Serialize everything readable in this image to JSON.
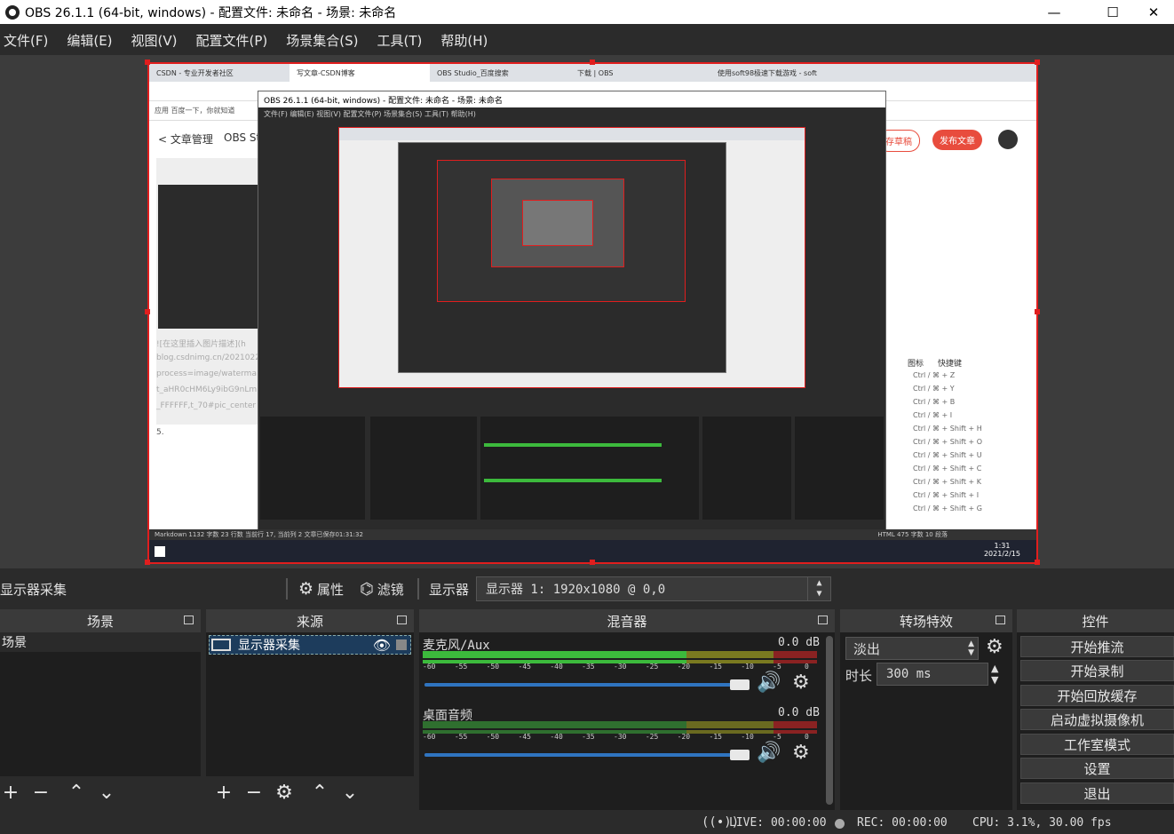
{
  "window": {
    "title": "OBS 26.1.1 (64-bit, windows) - 配置文件: 未命名 - 场景: 未命名",
    "minimize": "—",
    "maximize": "☐",
    "close": "✕"
  },
  "menu": [
    "文件(F)",
    "编辑(E)",
    "视图(V)",
    "配置文件(P)",
    "场景集合(S)",
    "工具(T)",
    "帮助(H)"
  ],
  "preview": {
    "browser_tabs": [
      "CSDN - 专业开发者社区",
      "写文章-CSDN博客",
      "OBS Studio_百度搜索",
      "下载 | OBS",
      "使用soft98极速下载游戏 - soft"
    ],
    "bookmarks": "应用   百度一下，你就知道",
    "editor_back": "< 文章管理",
    "editor_title": "OBS St",
    "inner_title": "OBS 26.1.1 (64-bit, windows) - 配置文件: 未命名 - 场景: 未命名",
    "inner_menu": "文件(F)  编辑(E)  视图(V)  配置文件(P)  场景集合(S)  工具(T)  帮助(H)",
    "left_text": [
      "![在这里插入图片描述](h",
      "blog.csdnimg.cn/2021022",
      "process=image/waterma",
      "t_aHR0cHM6Ly9ibG9nLm",
      "_FFFFFF,t_70#pic_center",
      "5."
    ],
    "save_draft": "存草稿",
    "publish": "发布文章",
    "shortcut_header": [
      "图标",
      "快捷键"
    ],
    "shortcuts": [
      "Ctrl / ⌘ + Z",
      "Ctrl / ⌘ + Y",
      "Ctrl / ⌘ + B",
      "Ctrl / ⌘ + I",
      "Ctrl / ⌘ + Shift + H",
      "Ctrl / ⌘ + Shift + O",
      "Ctrl / ⌘ + Shift + U",
      "Ctrl / ⌘ + Shift + C",
      "Ctrl / ⌘ + Shift + K",
      "Ctrl / ⌘ + Shift + I",
      "Ctrl / ⌘ + Shift + G"
    ],
    "status_left": "Markdown  1132 字数   23 行数   当前行 17, 当前列 2   文章已保存01:31:32",
    "status_right": "HTML  475 字数   10 段落",
    "clock_time": "1:31",
    "clock_date": "2021/2/15"
  },
  "source_toolbar": {
    "current_source": "显示器采集",
    "properties": "属性",
    "filters": "滤镜",
    "display_label": "显示器",
    "display_value": "显示器 1: 1920x1080 @ 0,0"
  },
  "scenes": {
    "header": "场景",
    "items": [
      "场景"
    ]
  },
  "sources": {
    "header": "来源",
    "items": [
      "显示器采集"
    ]
  },
  "mixer": {
    "header": "混音器",
    "tick_labels": [
      "-60",
      "-55",
      "-50",
      "-45",
      "-40",
      "-35",
      "-30",
      "-25",
      "-20",
      "-15",
      "-10",
      "-5",
      "0"
    ],
    "channels": [
      {
        "name": "麦克风/Aux",
        "db": "0.0 dB",
        "volume": 1.0
      },
      {
        "name": "桌面音频",
        "db": "0.0 dB",
        "volume": 1.0
      }
    ]
  },
  "transitions": {
    "header": "转场特效",
    "selected": "淡出",
    "duration_label": "时长",
    "duration_value": "300 ms"
  },
  "controls": {
    "header": "控件",
    "buttons": [
      "开始推流",
      "开始录制",
      "开始回放缓存",
      "启动虚拟摄像机",
      "工作室模式",
      "设置",
      "退出"
    ]
  },
  "status": {
    "live": "LIVE: 00:00:00",
    "rec": "REC: 00:00:00",
    "cpu": "CPU: 3.1%, 30.00 fps"
  },
  "colors": {
    "accent_red": "#e01e1e",
    "meter_green": "#3cba3c",
    "meter_yellow": "#bfbf2a",
    "meter_red": "#c33",
    "slider_blue": "#2f74c0"
  }
}
